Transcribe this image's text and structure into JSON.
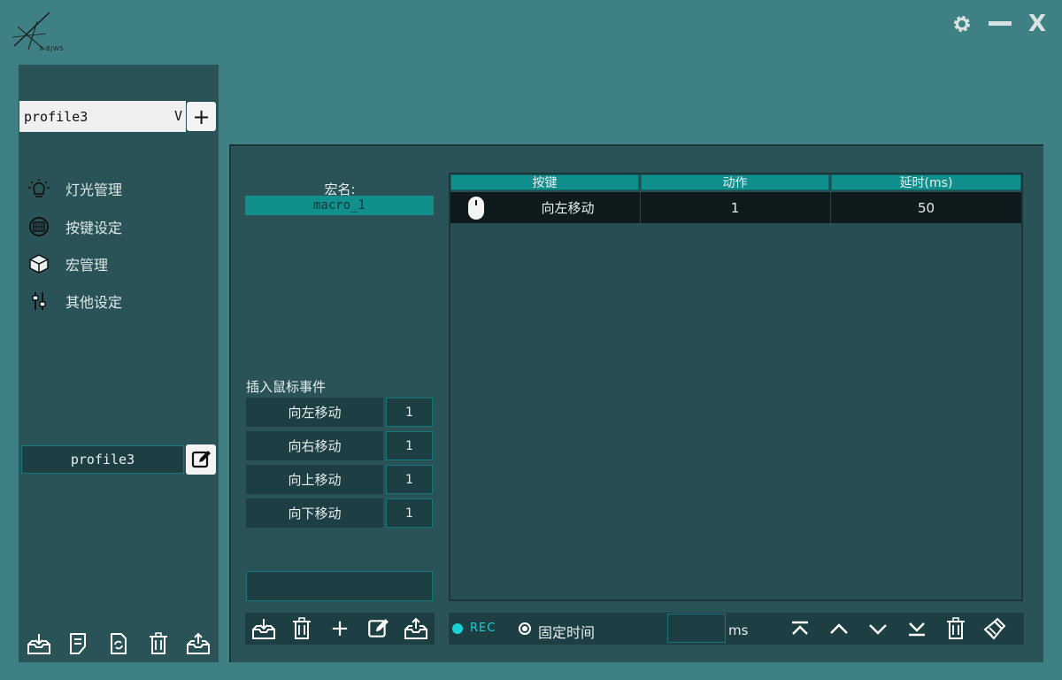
{
  "app": {
    "logo_text": "X·BJWS"
  },
  "window_controls": {
    "settings": "gear-icon",
    "minimize": "minimize-icon",
    "close_label": "X"
  },
  "sidebar": {
    "profile_select": {
      "value": "profile3",
      "chevron": "V"
    },
    "add_label": "+",
    "nav": [
      {
        "label": "灯光管理",
        "icon": "light-bulb-icon"
      },
      {
        "label": "按键设定",
        "icon": "keypad-icon"
      },
      {
        "label": "宏管理",
        "icon": "cube-icon"
      },
      {
        "label": "其他设定",
        "icon": "sliders-icon"
      }
    ],
    "profile_name": "profile3",
    "toolbar": [
      "import-icon",
      "notes-icon",
      "refresh-icon",
      "trash-icon",
      "export-icon"
    ]
  },
  "macro": {
    "name_label": "宏名:",
    "name_value": "macro_1",
    "insert_label": "插入鼠标事件",
    "mouse_events": [
      {
        "label": "向左移动",
        "value": "1"
      },
      {
        "label": "向右移动",
        "value": "1"
      },
      {
        "label": "向上移动",
        "value": "1"
      },
      {
        "label": "向下移动",
        "value": "1"
      }
    ],
    "toolbar": [
      "import-icon",
      "trash-icon",
      "plus-icon",
      "edit-icon",
      "export-icon"
    ],
    "plus_label": "+"
  },
  "table": {
    "columns": [
      "按键",
      "动作",
      "延时(ms)"
    ],
    "rows": [
      {
        "key": "向左移动",
        "action": "1",
        "delay": "50",
        "icon": "mouse-icon"
      }
    ]
  },
  "bottom": {
    "rec_label": "REC",
    "radio_label": "固定时间",
    "ms_value": "",
    "ms_unit": "ms",
    "tools": [
      "move-top-icon",
      "move-up-icon",
      "move-down-icon",
      "move-bottom-icon",
      "trash-icon",
      "clear-icon"
    ]
  },
  "colors": {
    "background": "#3f8084",
    "panel": "#2a5357",
    "accent": "#108f8c",
    "rec": "#1ad2d2"
  }
}
